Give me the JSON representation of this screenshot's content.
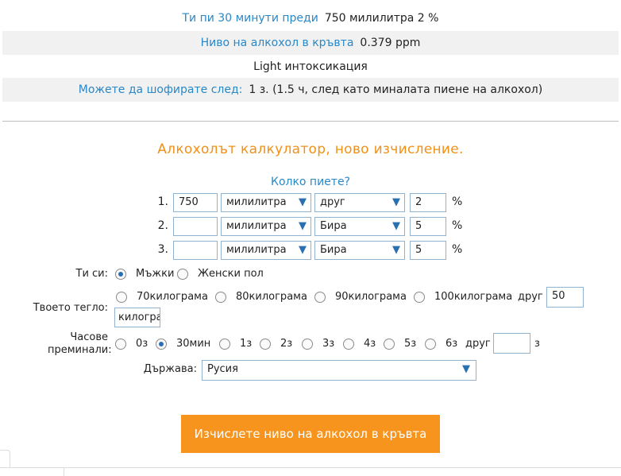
{
  "results": {
    "drank_label": "Ти пи 30 минути преди",
    "drank_value": "750 милилитра 2 %",
    "level_label": "Ниво на алкохол в кръвта",
    "level_value": "0.379 ppm",
    "intoxication": "Light интоксикация",
    "drive_label": "Можете да шофирате след:",
    "drive_value": "1 з. (1.5 ч, след като миналата пиене на алкохол)"
  },
  "calculator": {
    "title": "Алкохолът калкулатор, ново изчисление.",
    "question": "Колко пиете?",
    "drinks": [
      {
        "num": "1.",
        "amount": "750",
        "unit": "милилитра",
        "type": "друг",
        "percent": "2",
        "pct_sign": "%"
      },
      {
        "num": "2.",
        "amount": "",
        "unit": "милилитра",
        "type": "Бира",
        "percent": "5",
        "pct_sign": "%"
      },
      {
        "num": "3.",
        "amount": "",
        "unit": "милилитра",
        "type": "Бира",
        "percent": "5",
        "pct_sign": "%"
      }
    ],
    "gender": {
      "label": "Ти си:",
      "options": [
        "Мъжки",
        "Женски пол"
      ],
      "selected": "Мъжки"
    },
    "weight": {
      "label": "Твоето тегло:",
      "options": [
        "70килограма",
        "80килограма",
        "90килограма",
        "100килограма"
      ],
      "other_label": "друг",
      "other_value": "50",
      "unit_value": "килогра"
    },
    "hours": {
      "label_line1": "Часове",
      "label_line2": "преминали:",
      "options": [
        "0з",
        "30мин",
        "1з",
        "2з",
        "3з",
        "4з",
        "5з",
        "6з"
      ],
      "selected": "30мин",
      "other_label": "друг",
      "other_value": "",
      "unit": "з"
    },
    "country": {
      "label": "Държава:",
      "value": "Русия"
    },
    "submit": "Изчислете ниво на алкохол в кръвта"
  },
  "colors": {
    "accent": "#f7941d",
    "link": "#2a88c7"
  }
}
